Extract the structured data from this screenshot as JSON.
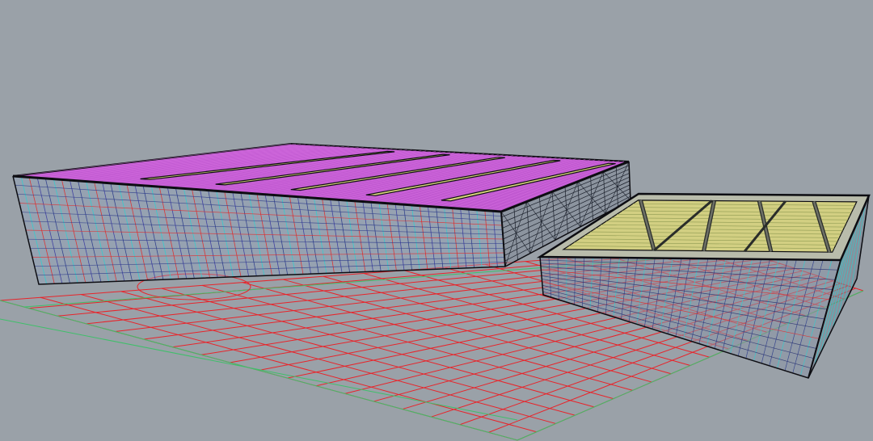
{
  "viewport": {
    "projection": "perspective",
    "display_mode": "wireframe"
  },
  "colors": {
    "background": "#9aa1a8",
    "grid_major": "#e8242a",
    "grid_minor": "#3fbf6a",
    "outline": "#0d0d12",
    "roof_magenta": "#c84cd8",
    "roof_yellow": "#d6d27a",
    "mesh_blue": "#2a3a8a",
    "mesh_cyan": "#2bd0d0",
    "mesh_red": "#e02a2a"
  },
  "objects": [
    {
      "id": "building-large",
      "kind": "mesh-box",
      "roof": "magenta-striped"
    },
    {
      "id": "building-small",
      "kind": "mesh-box",
      "roof": "yellow-glazed"
    }
  ]
}
